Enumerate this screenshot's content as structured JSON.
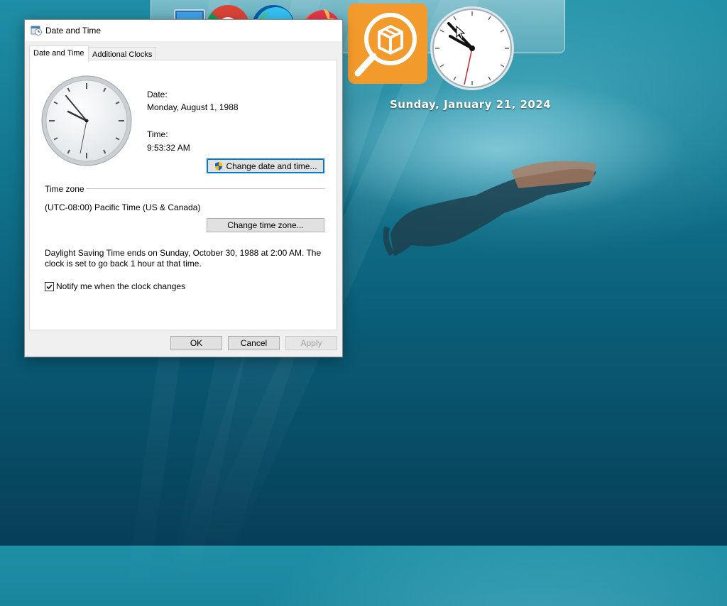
{
  "dialog": {
    "title": "Date and Time",
    "tabs": [
      {
        "label": "Date and Time",
        "active": true
      },
      {
        "label": "Additional Clocks",
        "active": false
      }
    ],
    "date_label": "Date:",
    "date_value": "Monday, August 1, 1988",
    "time_label": "Time:",
    "time_value": "9:53:32 AM",
    "change_datetime_button": "Change date and time...",
    "timezone_header": "Time zone",
    "timezone_value": "(UTC-08:00) Pacific Time (US & Canada)",
    "change_timezone_button": "Change time zone...",
    "dst_line1": "Daylight Saving Time ends on Sunday, October 30, 1988 at 2:00 AM. The",
    "dst_line2": "clock is set to go back 1 hour at that time.",
    "notify_label": "Notify me when the clock changes",
    "notify_checked": true,
    "ok_button": "OK",
    "cancel_button": "Cancel",
    "apply_button": "Apply"
  },
  "dock": {
    "items": [
      "computer-icon",
      "chrome-icon",
      "edge-icon",
      "firefox-icon",
      "package-search-icon",
      "clock-gadget"
    ]
  },
  "desktop_date": "Sunday, January 21, 2024",
  "colors": {
    "accent": "#0078d7",
    "package_app": "#f39a2c",
    "sea_top": "#1f8fa6",
    "sea_bottom": "#063f57"
  }
}
